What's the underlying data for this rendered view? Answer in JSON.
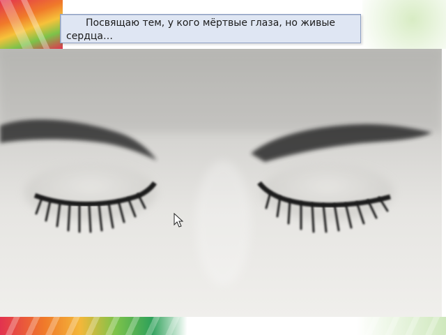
{
  "slide": {
    "caption": "Посвящаю тем, у кого мёртвые глаза, но живые сердца…"
  },
  "photo": {
    "icon": "closed-eyes-photo"
  },
  "cursor": {
    "icon": "mouse-pointer-icon"
  }
}
